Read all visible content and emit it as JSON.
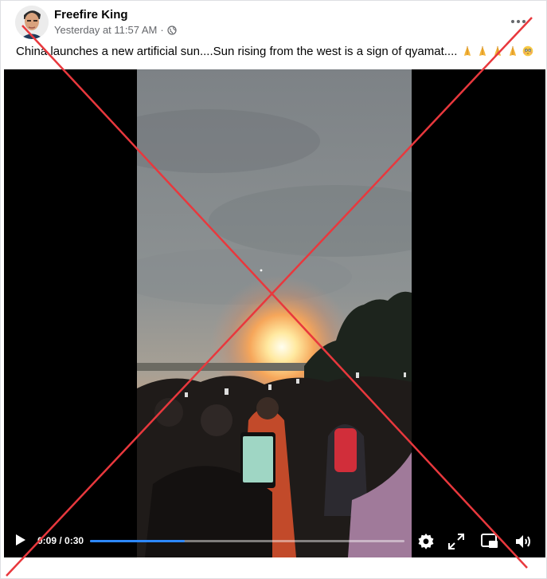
{
  "post": {
    "author": "Freefire King",
    "timestamp": "Yesterday at 11:57 AM",
    "separator": "·",
    "audience_icon": "globe-icon",
    "more_icon": "more-options-icon",
    "text": "China launches a new artificial sun....Sun rising from the west is a sign of qyamat....",
    "emojis": [
      "folded-hands-emoji",
      "folded-hands-emoji",
      "folded-hands-emoji",
      "folded-hands-emoji",
      "flushed-face-emoji"
    ]
  },
  "video": {
    "current_time": "0:09",
    "duration": "0:30",
    "time_display": "0:09 / 0:30",
    "progress": 0.3,
    "controls": [
      "play-icon",
      "settings-icon",
      "fullscreen-icon",
      "picture-in-picture-icon",
      "volume-icon"
    ],
    "accent_color": "#2d88ff"
  },
  "overlay": {
    "color": "#e8383d",
    "shape": "cross-out-x"
  }
}
